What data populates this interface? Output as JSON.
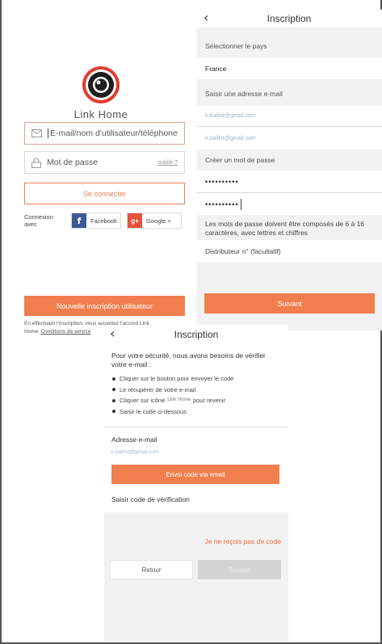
{
  "login": {
    "brand": "Link Home",
    "identifier_placeholder": "E-mail/nom d'utilisateur/téléphone",
    "password_placeholder": "Mot de passe",
    "forgot_label": "oublié ?",
    "login_button": "Se connecter",
    "social_label": "Connexion avec",
    "facebook_label": "Facebook",
    "google_label": "Google +",
    "new_user_button": "Nouvelle inscription utilisateur",
    "terms_text": "En effectuant l'inscription, vous acceptez l'accord Link Home",
    "terms_link": "Conditions de service"
  },
  "inscription": {
    "title": "Inscription",
    "country_label": "Sélectionner le pays",
    "country_value": "France",
    "email_label": "Saisir une adresse e-mail",
    "email_value": "k.baillot@gmail.com",
    "email_confirm_value": "k.baillot@gmail.com",
    "password_label": "Créer un mot de passe",
    "password_value": "••••••••••",
    "password_confirm_value": "••••••••••",
    "password_rules": "Les mots de passe doivent être composés de 6 à 16 caractères, avec lettres et chiffres",
    "distributor_label": "Distributeur n° (facultatif)",
    "next_button": "Suivant"
  },
  "verification": {
    "title": "Inscription",
    "intro": "Pour votre sécurité, nous avons besoins de vérifier votre e-mail :",
    "steps": [
      "Cliquer sur le bouton pour envoyer le code",
      "Le récupérer de votre e-mail",
      "Cliquer sur icône",
      "Saisir le code ci-dessous"
    ],
    "step3_app": "Link Home",
    "step3_suffix": "pour revenir",
    "email_label": "Adresse e-mail",
    "email_value": "k.baillot@gmail.com",
    "send_button": "Envoi code via email",
    "code_label": "Saisir code de vérification",
    "no_code_link": "Je ne reçois pas de code",
    "back_button": "Retour",
    "next_button": "Suivant"
  },
  "icons": {
    "logo": "camera-lens-logo",
    "mail": "mail-icon",
    "lock": "lock-icon",
    "back": "chevron-left-icon"
  },
  "colors": {
    "accent": "#f17f4e",
    "link_red": "#f06a3a",
    "facebook": "#3b5998",
    "google": "#e4533c",
    "panel_bg": "#f2f2f2"
  }
}
